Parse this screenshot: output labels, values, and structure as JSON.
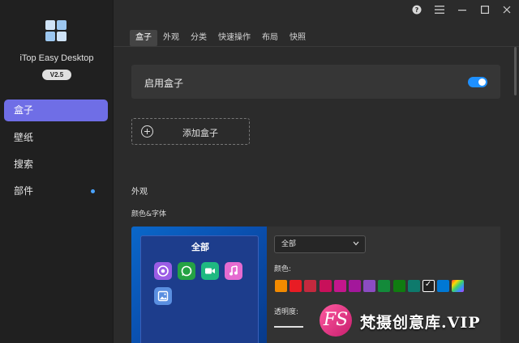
{
  "app": {
    "name": "iTop Easy Desktop",
    "version": "V2.5"
  },
  "sidebar": {
    "items": [
      {
        "label": "盒子",
        "active": true
      },
      {
        "label": "壁纸",
        "active": false
      },
      {
        "label": "搜索",
        "active": false
      },
      {
        "label": "部件",
        "active": false,
        "has_dot": true
      }
    ]
  },
  "titlebar": {
    "icons": [
      "help-icon",
      "menu-icon",
      "minimize-icon",
      "maximize-icon",
      "close-icon"
    ]
  },
  "tabs": [
    {
      "label": "盒子",
      "active": true
    },
    {
      "label": "外观"
    },
    {
      "label": "分类"
    },
    {
      "label": "快速操作"
    },
    {
      "label": "布局"
    },
    {
      "label": "快照"
    }
  ],
  "main": {
    "enable_box_label": "启用盒子",
    "enable_box_on": true,
    "add_box_label": "添加盒子",
    "appearance_title": "外观",
    "color_font_title": "颜色&字体",
    "preview_title": "全部",
    "select_value": "全部",
    "color_label": "颜色:",
    "opacity_label": "透明度:"
  },
  "swatch_colors": [
    "#f28a00",
    "#e81c24",
    "#c4293e",
    "#c8105a",
    "#c4168c",
    "#a3179b",
    "#8b4cc2",
    "#138a3a",
    "#107c10",
    "#0e7a6c",
    "#202020",
    "#0078d4",
    "rainbow"
  ],
  "accent_color": "#6f6ee6",
  "toggle_color": "#1e90ff",
  "watermark": {
    "logo": "FS",
    "text": "梵摄创意库.VIP"
  }
}
